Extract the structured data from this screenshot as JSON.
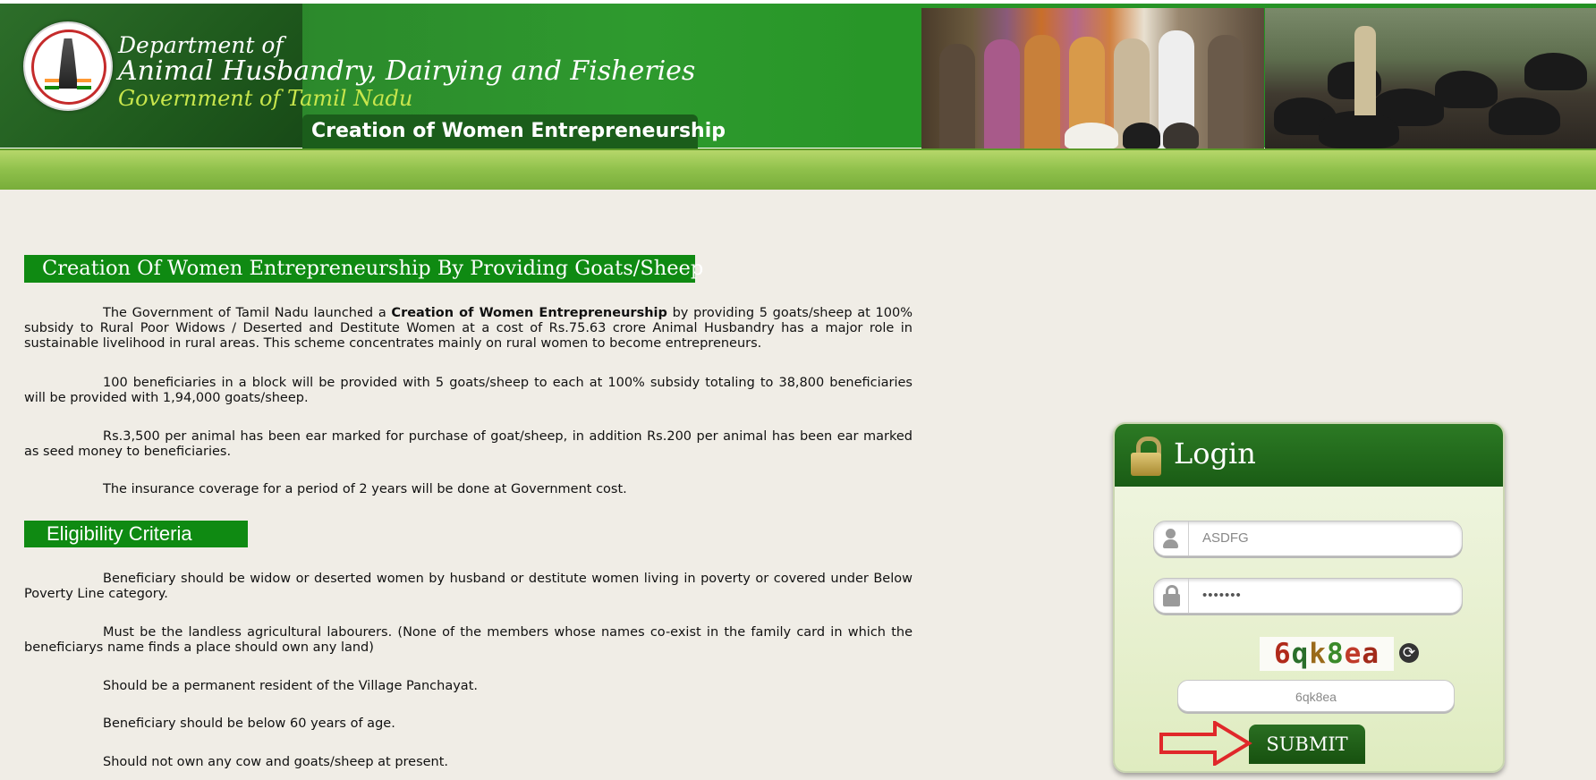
{
  "header": {
    "dept_prefix": "Department of",
    "dept_name": "Animal Husbandry, Dairying and Fisheries",
    "government": "Government of Tamil Nadu",
    "scheme_tab": "Creation of Women Entrepreneurship"
  },
  "content": {
    "title": "Creation Of Women Entrepreneurship By Providing Goats/Sheep",
    "intro_before": "The Government of Tamil Nadu launched a ",
    "intro_bold": "Creation of Women Entrepreneurship",
    "intro_after": " by providing 5 goats/sheep at 100% subsidy to Rural Poor Widows / Deserted and Destitute Women at a cost of Rs.75.63 crore Animal Husbandry has a major role in sustainable livelihood in rural areas. This scheme concentrates mainly on rural women to become entrepreneurs.",
    "para2": "100 beneficiaries in a block will be provided with 5 goats/sheep to each at 100% subsidy totaling to 38,800 beneficiaries will be provided with 1,94,000 goats/sheep.",
    "para3": "Rs.3,500 per animal has been ear marked for purchase of goat/sheep, in addition Rs.200 per animal has been ear marked as seed money to beneficiaries.",
    "para4": "The insurance coverage for a period of 2 years will be done at Government cost.",
    "eligibility_title": "Eligibility Criteria",
    "elig1": "Beneficiary should be widow or deserted women by husband or destitute women living in poverty or covered under Below Poverty Line category.",
    "elig2": "Must be the landless agricultural labourers. (None of the members whose names co-exist in the family card in which the beneficiarys name finds a place should own any land)",
    "elig3": "Should be a permanent resident of the Village Panchayat.",
    "elig4": "Beneficiary should be below 60 years of age.",
    "elig5": "Should not own any cow and goats/sheep at present."
  },
  "login": {
    "title": "Login",
    "username_value": "ASDFG",
    "password_value": "•••••••",
    "captcha_text": "6qk8ea",
    "captcha_chars": [
      {
        "ch": "6",
        "color": "#b02a1a"
      },
      {
        "ch": "q",
        "color": "#2a6e2a"
      },
      {
        "ch": "k",
        "color": "#9a6a1a"
      },
      {
        "ch": "8",
        "color": "#3a8a2a"
      },
      {
        "ch": "e",
        "color": "#c03a2a"
      },
      {
        "ch": "a",
        "color": "#a22a1a"
      }
    ],
    "captcha_input_value": "6qk8ea",
    "submit_label": "SUBMIT",
    "refresh_symbol": "⟳"
  },
  "colors": {
    "header_green": "#2e9a2e",
    "section_bar": "#0f8a12",
    "login_header": "#1a5c15",
    "arrow": "#e0282a"
  },
  "icons": [
    "emblem-icon",
    "lock-icon",
    "user-icon",
    "password-lock-icon",
    "refresh-icon",
    "arrow-icon"
  ]
}
